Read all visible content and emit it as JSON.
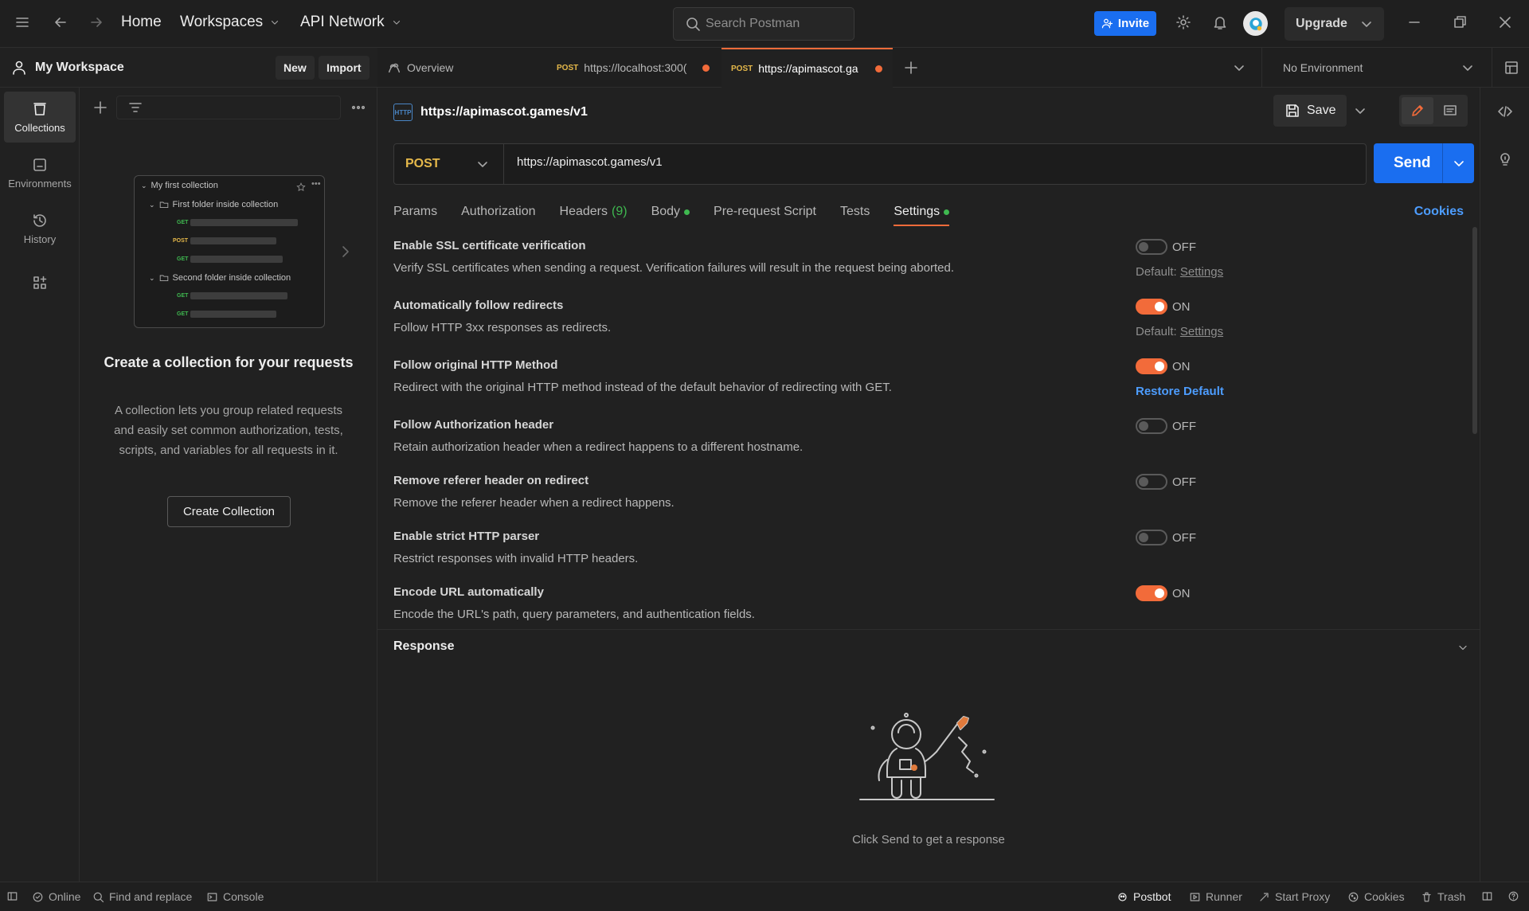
{
  "topbar": {
    "home": "Home",
    "workspaces": "Workspaces",
    "api_network": "API Network",
    "search_placeholder": "Search Postman",
    "invite": "Invite",
    "upgrade": "Upgrade"
  },
  "workspace": {
    "name": "My Workspace",
    "new_label": "New",
    "import_label": "Import"
  },
  "rail": [
    {
      "label": "Collections",
      "icon": "collections-icon"
    },
    {
      "label": "Environments",
      "icon": "environments-icon"
    },
    {
      "label": "History",
      "icon": "history-icon"
    }
  ],
  "illustration": {
    "collection": "My first collection",
    "folder1": "First folder inside collection",
    "folder2": "Second folder inside collection",
    "m_get": "GET",
    "m_post": "POST"
  },
  "sidebar": {
    "empty_title": "Create a collection for your requests",
    "empty_desc": "A collection lets you group related requests and easily set common authorization, tests, scripts, and variables for all requests in it.",
    "create_button": "Create Collection"
  },
  "tabs": [
    {
      "label": "Overview"
    },
    {
      "method": "POST",
      "label": "https://localhost:300("
    },
    {
      "method": "POST",
      "label": "https://apimascot.ga"
    }
  ],
  "environment": "No Environment",
  "request": {
    "title": "https://apimascot.games/v1",
    "save": "Save",
    "method": "POST",
    "url": "https://apimascot.games/v1",
    "send": "Send",
    "cookies": "Cookies",
    "tabs": [
      {
        "label": "Params"
      },
      {
        "label": "Authorization"
      },
      {
        "label": "Headers",
        "count": "(9)"
      },
      {
        "label": "Body"
      },
      {
        "label": "Pre-request Script"
      },
      {
        "label": "Tests"
      },
      {
        "label": "Settings"
      }
    ]
  },
  "settings": [
    {
      "title": "Enable SSL certificate verification",
      "desc": "Verify SSL certificates when sending a request. Verification failures will result in the request being aborted.",
      "state": "OFF",
      "note_prefix": "Default:",
      "note_link": "Settings"
    },
    {
      "title": "Automatically follow redirects",
      "desc": "Follow HTTP 3xx responses as redirects.",
      "state": "ON",
      "note_prefix": "Default:",
      "note_link": "Settings"
    },
    {
      "title": "Follow original HTTP Method",
      "desc": "Redirect with the original HTTP method instead of the default behavior of redirecting with GET.",
      "state": "ON",
      "note_link": "Restore Default"
    },
    {
      "title": "Follow Authorization header",
      "desc": "Retain authorization header when a redirect happens to a different hostname.",
      "state": "OFF"
    },
    {
      "title": "Remove referer header on redirect",
      "desc": "Remove the referer header when a redirect happens.",
      "state": "OFF"
    },
    {
      "title": "Enable strict HTTP parser",
      "desc": "Restrict responses with invalid HTTP headers.",
      "state": "OFF"
    },
    {
      "title": "Encode URL automatically",
      "desc": "Encode the URL's path, query parameters, and authentication fields.",
      "state": "ON"
    }
  ],
  "response": {
    "title": "Response",
    "empty": "Click Send to get a response"
  },
  "statusbar": {
    "online": "Online",
    "find_replace": "Find and replace",
    "console": "Console",
    "postbot": "Postbot",
    "runner": "Runner",
    "start_proxy": "Start Proxy",
    "cookies": "Cookies",
    "trash": "Trash"
  },
  "colors": {
    "accent": "#f26b3a",
    "primary": "#1a6ef0",
    "link": "#4d9dff",
    "method_post": "#e5b84a"
  }
}
